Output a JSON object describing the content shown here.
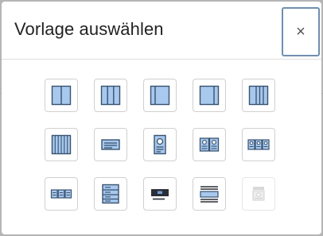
{
  "dialog": {
    "title": "Vorlage auswählen",
    "close_label": "×"
  },
  "templates": [
    {
      "icon": "two-columns-icon"
    },
    {
      "icon": "three-columns-icon"
    },
    {
      "icon": "sidebar-right-icon"
    },
    {
      "icon": "sidebar-left-icon"
    },
    {
      "icon": "four-columns-icon"
    },
    {
      "icon": "six-columns-icon"
    },
    {
      "icon": "text-box-icon"
    },
    {
      "icon": "profile-card-icon"
    },
    {
      "icon": "two-cards-icon"
    },
    {
      "icon": "three-cards-icon"
    },
    {
      "icon": "three-boxes-icon"
    },
    {
      "icon": "stacked-list-icon"
    },
    {
      "icon": "image-caption-icon"
    },
    {
      "icon": "text-lines-icon"
    },
    {
      "icon": "media-block-disabled-icon",
      "disabled": true
    }
  ],
  "colors": {
    "fill": "#a8c8ee",
    "stroke": "#38526e",
    "dark": "#2b2f36",
    "disabled": "#c8c8c8"
  }
}
